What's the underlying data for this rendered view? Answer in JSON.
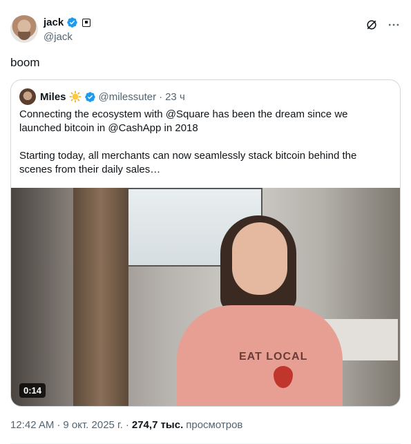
{
  "author": {
    "name": "jack",
    "handle": "@jack"
  },
  "tweet": {
    "text": "boom"
  },
  "quote": {
    "name": "Miles",
    "handle": "@milessuter",
    "dot": "·",
    "time": "23 ч",
    "paragraph1": "Connecting the ecosystem with @Square has been the dream since we launched bitcoin in @CashApp in 2018",
    "paragraph2": "Starting today, all merchants can now seamlessly stack bitcoin behind the scenes from their daily sales…",
    "media": {
      "duration": "0:14",
      "shirt_text": "EAT LOCAL"
    }
  },
  "meta": {
    "time": "12:42 AM",
    "sep1": "·",
    "date": "9 окт. 2025 г.",
    "sep2": "·",
    "views_count": "274,7 тыс.",
    "views_label": "просмотров"
  },
  "colors": {
    "verified": "#1d9bf0",
    "muted": "#536471",
    "border": "#cfd9de"
  },
  "icons": [
    "verified-badge-icon",
    "affiliate-badge-icon",
    "grok-icon",
    "more-icon",
    "sun-emoji-icon"
  ]
}
